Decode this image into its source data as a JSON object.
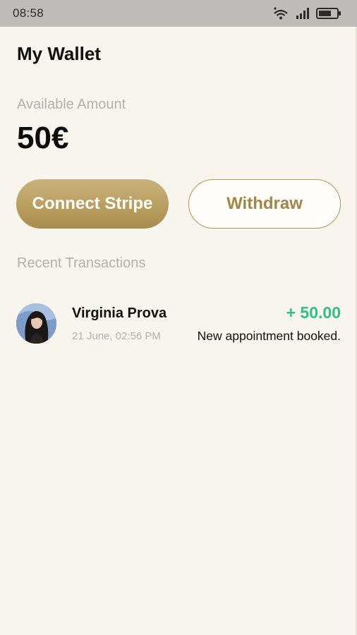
{
  "status_bar": {
    "time": "08:58",
    "icons": [
      "wifi-icon",
      "signal-icon",
      "battery-icon"
    ]
  },
  "page": {
    "title": "My Wallet"
  },
  "wallet": {
    "available_label": "Available Amount",
    "amount": "50€"
  },
  "actions": {
    "connect_label": "Connect Stripe",
    "withdraw_label": "Withdraw"
  },
  "transactions": {
    "section_label": "Recent Transactions",
    "items": [
      {
        "name": "Virginia Prova",
        "amount": "+ 50.00",
        "date": "21 June, 02:56 PM",
        "description": "New appointment booked."
      }
    ]
  },
  "colors": {
    "background": "#f8f4ee",
    "accent_gold": "#b89c5e",
    "positive_green": "#2fbf86",
    "muted_text": "#b3b0ab"
  }
}
